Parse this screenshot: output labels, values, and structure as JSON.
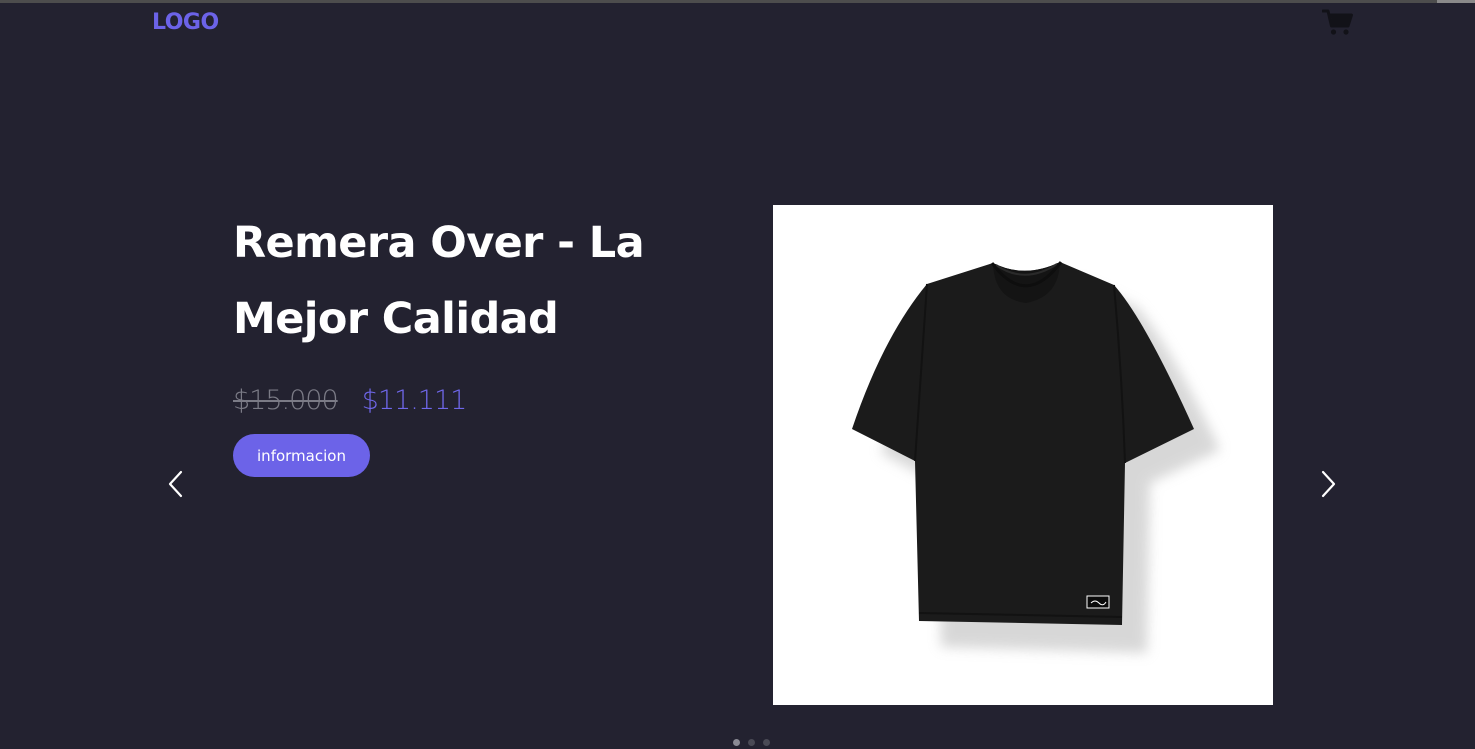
{
  "header": {
    "logo_text": "LOGO",
    "cart_icon": "shopping-cart-icon"
  },
  "hero": {
    "title": "Remera Over - La Mejor Calidad",
    "old_price": "$15.000",
    "new_price": "$11.111",
    "button_label": "informacion",
    "prev_icon": "chevron-left-icon",
    "next_icon": "chevron-right-icon",
    "image_subject": "black oversized t-shirt"
  },
  "carousel": {
    "slide_count": 3,
    "active_index": 0
  },
  "colors": {
    "background": "#232230",
    "accent": "#6c63e8",
    "old_price": "#7b7b86",
    "text": "#ffffff"
  }
}
